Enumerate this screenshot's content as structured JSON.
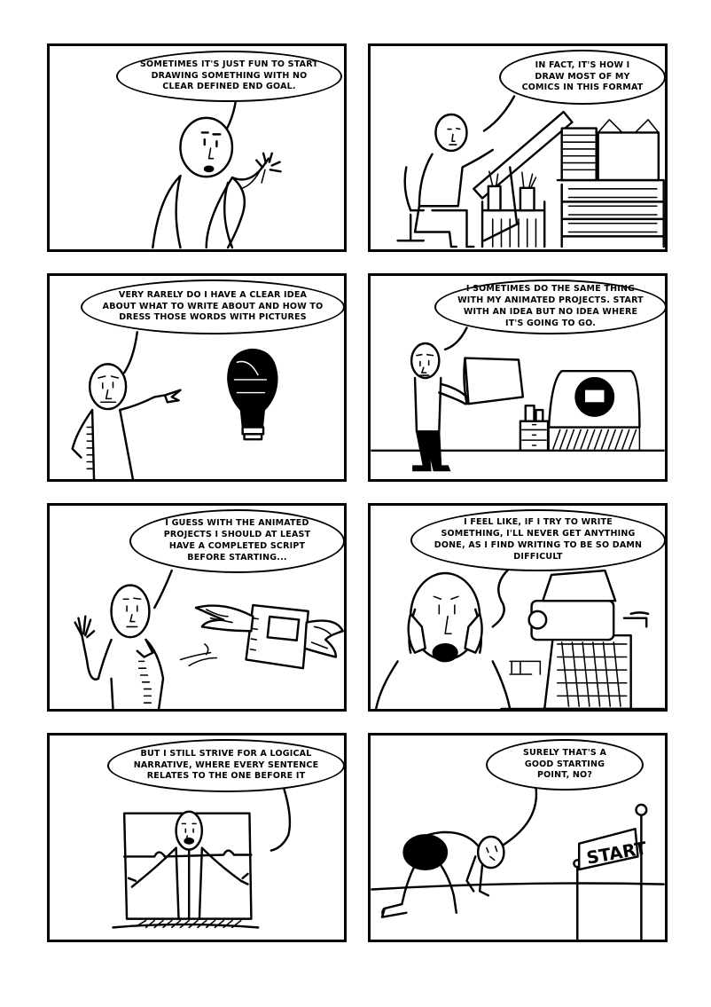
{
  "comic": {
    "panels": [
      {
        "id": 1,
        "caption": "SOMETIMES IT'S JUST FUN TO START DRAWING SOMETHING WITH NO CLEAR DEFINED END GOAL."
      },
      {
        "id": 2,
        "caption": "IN FACT, IT'S HOW I DRAW MOST OF MY COMICS IN THIS FORMAT"
      },
      {
        "id": 3,
        "caption": "VERY RARELY DO I HAVE A CLEAR IDEA ABOUT WHAT TO WRITE ABOUT AND HOW TO DRESS THOSE WORDS WITH PICTURES"
      },
      {
        "id": 4,
        "caption": "I SOMETIMES DO THE SAME THING WITH MY ANIMATED PROJECTS. START WITH AN IDEA BUT NO IDEA WHERE IT'S GOING TO GO."
      },
      {
        "id": 5,
        "caption": "I GUESS WITH THE ANIMATED PROJECTS I SHOULD AT LEAST HAVE A COMPLETED SCRIPT BEFORE STARTING..."
      },
      {
        "id": 6,
        "caption": "I FEEL LIKE, IF I TRY TO WRITE SOMETHING, I'LL NEVER GET ANYTHING DONE, AS I FIND WRITING TO BE SO DAMN DIFFICULT"
      },
      {
        "id": 7,
        "caption": "BUT I STILL STRIVE FOR A LOGICAL NARRATIVE, WHERE EVERY SENTENCE RELATES TO THE ONE BEFORE IT"
      },
      {
        "id": 8,
        "caption": "SURELY THAT'S A GOOD STARTING POINT, NO?",
        "sign": "START"
      }
    ]
  }
}
